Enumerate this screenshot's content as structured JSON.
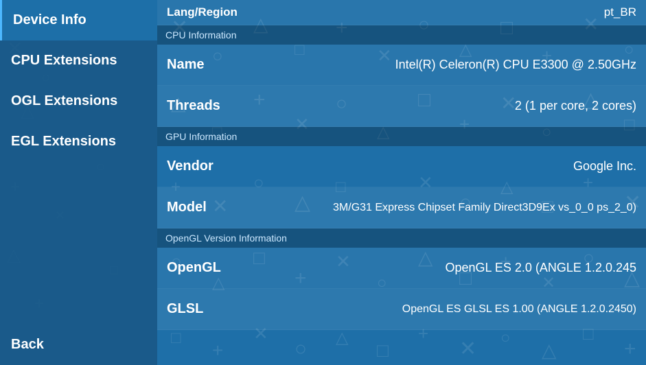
{
  "sidebar": {
    "items": [
      {
        "id": "device-info",
        "label": "Device Info",
        "active": true
      },
      {
        "id": "cpu-extensions",
        "label": "CPU Extensions",
        "active": false
      },
      {
        "id": "ogl-extensions",
        "label": "OGL Extensions",
        "active": false
      },
      {
        "id": "egl-extensions",
        "label": "EGL Extensions",
        "active": false
      }
    ],
    "back_label": "Back"
  },
  "main": {
    "sections": [
      {
        "id": "cpu-info",
        "header": "CPU Information",
        "rows": [
          {
            "label": "Name",
            "value": "Intel(R) Celeron(R) CPU    E3300 @ 2.50GHz"
          },
          {
            "label": "Threads",
            "value": "2 (1 per core, 2 cores)"
          }
        ]
      },
      {
        "id": "gpu-info",
        "header": "GPU Information",
        "rows": [
          {
            "label": "Vendor",
            "value": "Google Inc."
          },
          {
            "label": "Model",
            "value": "3M/G31 Express Chipset Family Direct3D9Ex vs_0_0 ps_2_0)"
          }
        ]
      },
      {
        "id": "opengl-version",
        "header": "OpenGL Version Information",
        "rows": [
          {
            "label": "OpenGL",
            "value": "OpenGL ES 2.0 (ANGLE 1.2.0.245"
          },
          {
            "label": "GLSL",
            "value": "OpenGL ES GLSL ES 1.00 (ANGLE 1.2.0.2450)"
          }
        ]
      }
    ]
  },
  "colors": {
    "sidebar_bg": "#1a5a8a",
    "sidebar_active": "#1d6fa8",
    "main_bg": "#1e6fa8",
    "section_header_bg": "rgba(0,0,0,0.25)",
    "text_primary": "#ffffff",
    "text_secondary": "#cce8ff"
  }
}
